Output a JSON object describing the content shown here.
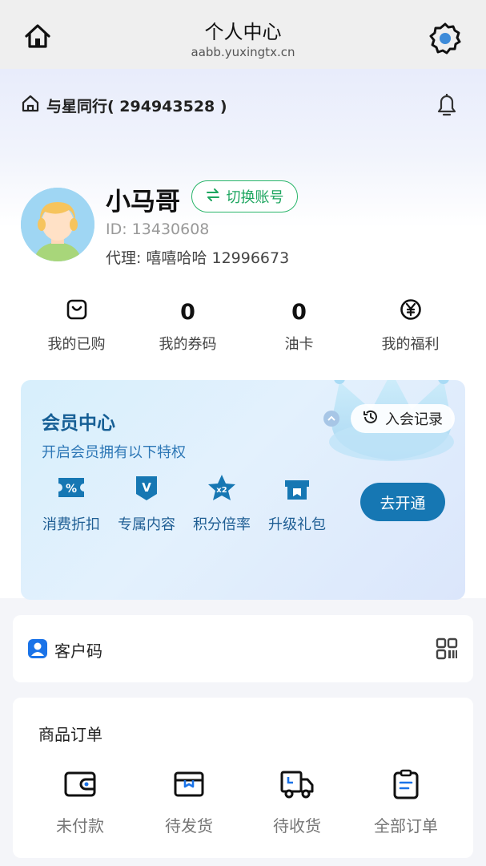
{
  "header": {
    "title": "个人中心",
    "url": "aabb.yuxingtx.cn",
    "home_icon": "home-icon",
    "settings_icon": "gear-icon"
  },
  "shop": {
    "name": "与星同行( 294943528 )",
    "home_icon": "home-outline-icon",
    "notify_icon": "bell-icon"
  },
  "profile": {
    "username": "小马哥",
    "switch_label": "切换账号",
    "id_text": "ID: 13430608",
    "agent_text": "代理: 嘻嘻哈哈 12996673"
  },
  "stats": [
    {
      "label": "我的已购",
      "value": null,
      "icon": "bag-icon"
    },
    {
      "label": "我的券码",
      "value": "0"
    },
    {
      "label": "油卡",
      "value": "0"
    },
    {
      "label": "我的福利",
      "value": null,
      "icon": "yen-circle-icon"
    }
  ],
  "vip": {
    "title": "会员中心",
    "subtitle": "开启会员拥有以下特权",
    "record_label": "入会记录",
    "open_label": "去开通",
    "perks": [
      {
        "label": "消费折扣",
        "icon": "discount-ticket-icon",
        "glyph": "%"
      },
      {
        "label": "专属内容",
        "icon": "exclusive-v-icon",
        "glyph": "V"
      },
      {
        "label": "积分倍率",
        "icon": "points-star-icon",
        "glyph": "x2"
      },
      {
        "label": "升级礼包",
        "icon": "gift-box-icon",
        "glyph": ""
      }
    ],
    "accent": "#1677b3"
  },
  "customer_code": {
    "label": "客户码",
    "icon": "user-badge-icon",
    "qr_icon": "qr-code-icon"
  },
  "orders": {
    "title": "商品订单",
    "items": [
      {
        "label": "未付款",
        "icon": "wallet-icon"
      },
      {
        "label": "待发货",
        "icon": "package-icon"
      },
      {
        "label": "待收货",
        "icon": "truck-icon"
      },
      {
        "label": "全部订单",
        "icon": "clipboard-icon"
      }
    ]
  }
}
